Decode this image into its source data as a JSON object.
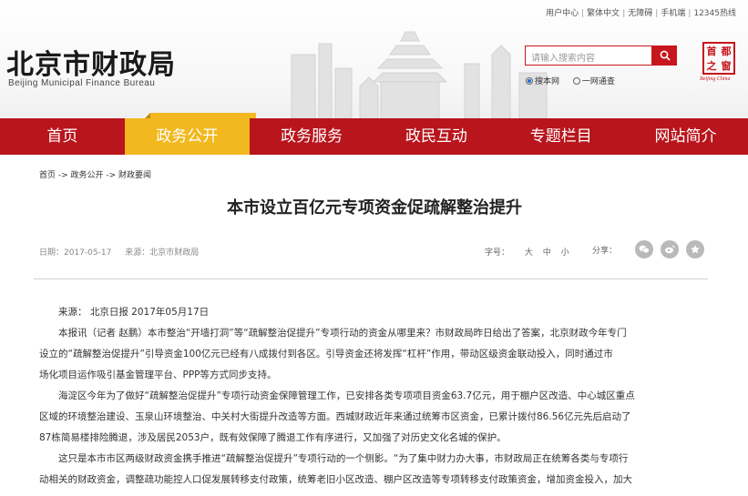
{
  "top_links": [
    "用户中心",
    "繁体中文",
    "无障碍",
    "手机端",
    "12345热线"
  ],
  "logo": {
    "cn": "北京市财政局",
    "en": "Beijing Municipal Finance Bureau"
  },
  "search": {
    "placeholder": "请输入搜索内容",
    "scope_site": "搜本网",
    "scope_all": "一网通查"
  },
  "seal": {
    "chars": [
      "首",
      "都",
      "之",
      "窗"
    ],
    "caption": "Beijing China"
  },
  "nav": [
    {
      "label": "首页"
    },
    {
      "label": "政务公开"
    },
    {
      "label": "政务服务"
    },
    {
      "label": "政民互动"
    },
    {
      "label": "专题栏目"
    },
    {
      "label": "网站简介"
    }
  ],
  "nav_active_index": 1,
  "breadcrumb": "首页 -> 政务公开 -> 财政要闻",
  "article": {
    "title": "本市设立百亿元专项资金促疏解整治提升",
    "date": "日期：2017-05-17",
    "source_meta": "来源：北京市财政局",
    "font_label": "字号：",
    "font_sizes": [
      "大",
      "中",
      "小"
    ],
    "share_label": "分享：",
    "source_line": "来源：  北京日报  2017年05月17日",
    "para1_l1": "本报讯（记者 赵鹏）本市整治“开墙打洞”等“疏解整治促提升”专项行动的资金从哪里来？市财政局昨日给出了答案，北京财政今年专门",
    "para1_l2": "设立的“疏解整治促提升”引导资金100亿元已经有八成拨付到各区。引导资金还将发挥“杠杆”作用，带动区级资金联动投入，同时通过市",
    "para1_l3": "场化项目运作吸引基金管理平台、PPP等方式同步支持。",
    "para2_l1": "海淀区今年为了做好“疏解整治促提升”专项行动资金保障管理工作，已安排各类专项项目资金63.7亿元，用于棚户区改造、中心城区重点",
    "para2_l2": "区域的环境整治建设、玉泉山环境整治、中关村大街提升改造等方面。西城财政近年来通过统筹市区资金，已累计拨付86.56亿元先后启动了",
    "para2_l3": "87栋简易楼排险腾退，涉及居民2053户，既有效保障了腾退工作有序进行，又加强了对历史文化名城的保护。",
    "para3_l1": "这只是本市市区两级财政资金携手推进“疏解整治促提升”专项行动的一个侧影。“为了集中财力办大事，市财政局正在统筹各类与专项行",
    "para3_l2": "动相关的财政资金，调整疏功能控人口促发展转移支付政策，统筹老旧小区改造、棚户区改造等专项转移支付政策资金，增加资金投入，加大"
  },
  "colors": {
    "brand_red": "#b8151c",
    "active_yellow": "#f2b81f"
  }
}
